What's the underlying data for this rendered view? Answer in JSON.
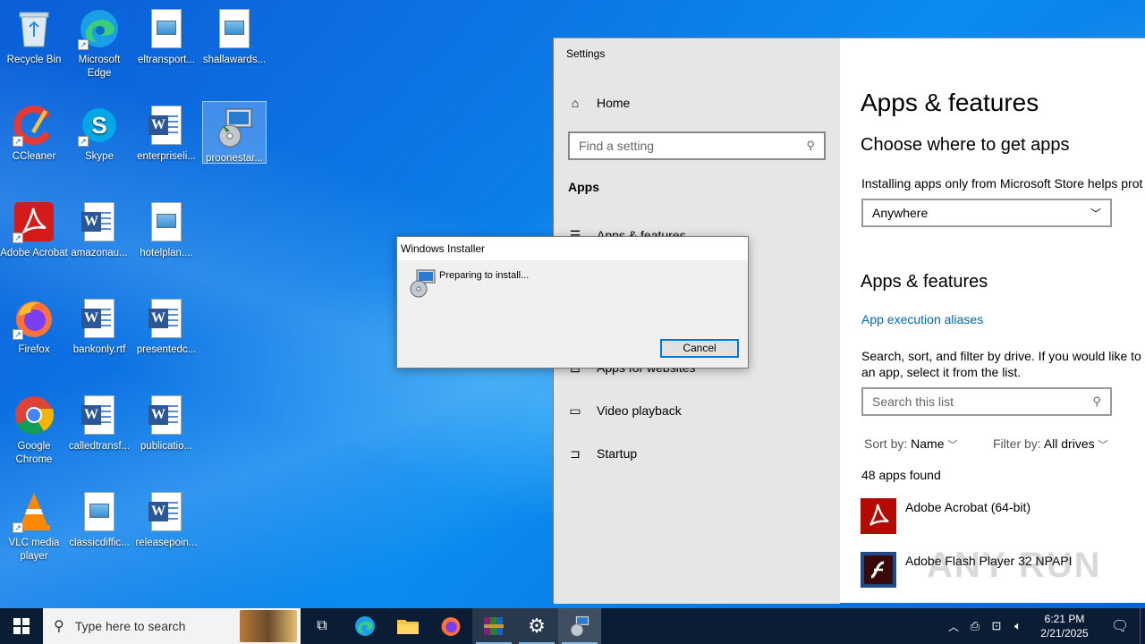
{
  "desktop": {
    "icons": [
      {
        "label": "Recycle Bin",
        "icon": "recycle-bin-icon"
      },
      {
        "label": "Microsoft Edge",
        "icon": "edge-icon"
      },
      {
        "label": "eltransport...",
        "icon": "image-file-icon"
      },
      {
        "label": "shallawards...",
        "icon": "image-file-icon"
      },
      {
        "label": "CCleaner",
        "icon": "ccleaner-icon"
      },
      {
        "label": "Skype",
        "icon": "skype-icon"
      },
      {
        "label": "enterpriseli...",
        "icon": "word-doc-icon"
      },
      {
        "label": "proonestar...",
        "icon": "installer-icon"
      },
      {
        "label": "Adobe Acrobat",
        "icon": "acrobat-icon"
      },
      {
        "label": "amazonau...",
        "icon": "word-doc-icon"
      },
      {
        "label": "hotelplan....",
        "icon": "image-file-icon"
      },
      {
        "label": "Firefox",
        "icon": "firefox-icon"
      },
      {
        "label": "bankonly.rtf",
        "icon": "word-doc-icon"
      },
      {
        "label": "presentedc...",
        "icon": "word-doc-icon"
      },
      {
        "label": "Google Chrome",
        "icon": "chrome-icon"
      },
      {
        "label": "calledtransf...",
        "icon": "word-doc-icon"
      },
      {
        "label": "publicatio...",
        "icon": "word-doc-icon"
      },
      {
        "label": "VLC media player",
        "icon": "vlc-icon"
      },
      {
        "label": "classicdiffic...",
        "icon": "image-file-icon"
      },
      {
        "label": "releasepoin...",
        "icon": "word-doc-icon"
      }
    ]
  },
  "settings": {
    "window_title": "Settings",
    "nav": {
      "home": "Home",
      "search_placeholder": "Find a setting",
      "section": "Apps",
      "items": [
        "Apps & features",
        "Apps for websites",
        "Video playback",
        "Startup"
      ]
    },
    "content": {
      "title": "Apps & features",
      "choose_heading": "Choose where to get apps",
      "choose_text": "Installing apps only from Microsoft Store helps prot",
      "dropdown_value": "Anywhere",
      "apps_heading": "Apps & features",
      "aliases_link": "App execution aliases",
      "search_text_1": "Search, sort, and filter by drive. If you would like to u",
      "search_text_2": "an app, select it from the list.",
      "search_placeholder": "Search this list",
      "sort_label": "Sort by:",
      "sort_value": "Name",
      "filter_label": "Filter by:",
      "filter_value": "All drives",
      "count": "48 apps found",
      "apps": [
        "Adobe Acrobat (64-bit)",
        "Adobe Flash Player 32 NPAPI"
      ]
    }
  },
  "installer": {
    "title": "Windows Installer",
    "message": "Preparing to install...",
    "cancel": "Cancel"
  },
  "taskbar": {
    "search_placeholder": "Type here to search",
    "time": "6:21 PM",
    "date": "2/21/2025"
  },
  "watermark": "ANY RUN"
}
